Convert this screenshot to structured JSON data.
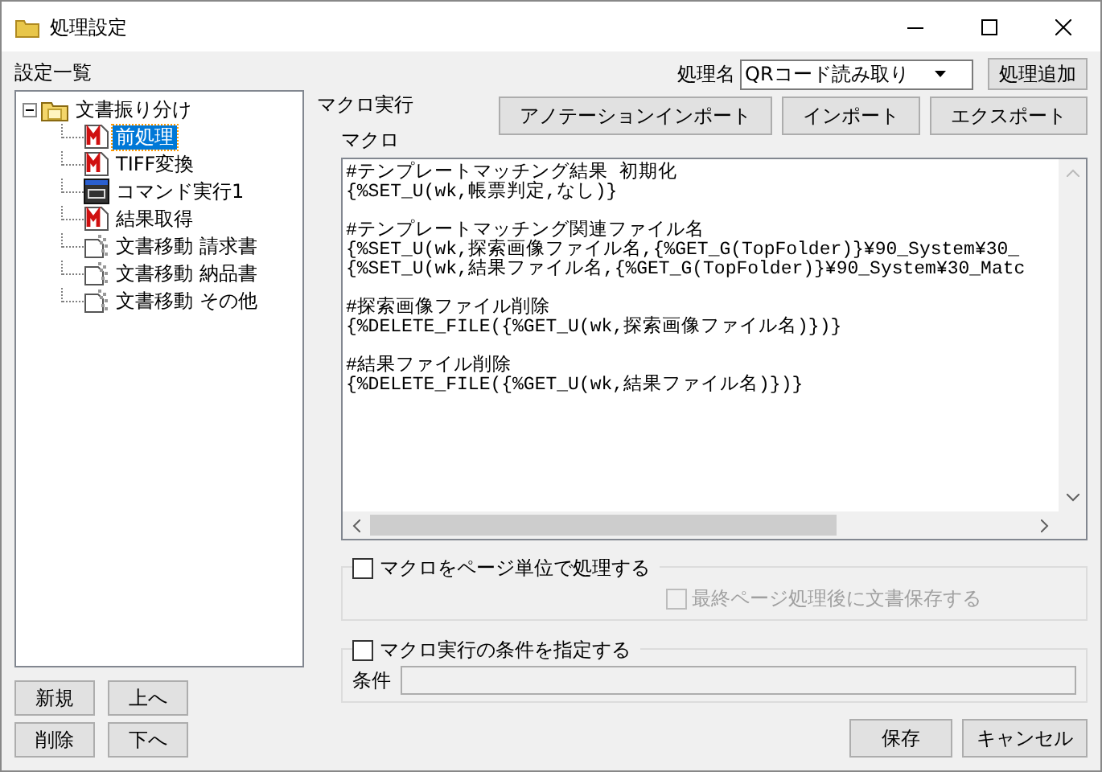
{
  "window": {
    "title": "処理設定"
  },
  "sidebar": {
    "label": "設定一覧",
    "tree": [
      {
        "label": "文書振り分け",
        "kind": "folder",
        "expanded": true,
        "selected": false,
        "children": [
          {
            "label": "前処理",
            "kind": "macro",
            "selected": true
          },
          {
            "label": "TIFF変換",
            "kind": "macro",
            "selected": false
          },
          {
            "label": "コマンド実行1",
            "kind": "command",
            "selected": false
          },
          {
            "label": "結果取得",
            "kind": "macro",
            "selected": false
          },
          {
            "label": "文書移動 請求書",
            "kind": "move",
            "selected": false
          },
          {
            "label": "文書移動 納品書",
            "kind": "move",
            "selected": false
          },
          {
            "label": "文書移動 その他",
            "kind": "move",
            "selected": false
          }
        ]
      }
    ],
    "buttons": [
      "新規",
      "上へ",
      "削除",
      "下へ"
    ]
  },
  "process": {
    "label": "処理名",
    "value": "QRコード読み取り",
    "add_button": "処理追加"
  },
  "macro_section": {
    "title": "マクロ実行",
    "macro_label": "マクロ",
    "buttons": [
      "アノテーションインポート",
      "インポート",
      "エクスポート"
    ],
    "blocks": [
      {
        "lines": [
          "#テンプレートマッチング結果 初期化",
          "{%SET_U(wk,帳票判定,なし)}"
        ]
      },
      {
        "lines": [
          "#テンプレートマッチング関連ファイル名",
          "{%SET_U(wk,探索画像ファイル名,{%GET_G(TopFolder)}¥90_System¥30_",
          "{%SET_U(wk,結果ファイル名,{%GET_G(TopFolder)}¥90_System¥30_Matc"
        ]
      },
      {
        "lines": [
          "#探索画像ファイル削除",
          "{%DELETE_FILE({%GET_U(wk,探索画像ファイル名)})}"
        ]
      },
      {
        "lines": [
          "#結果ファイル削除",
          "{%DELETE_FILE({%GET_U(wk,結果ファイル名)})}"
        ]
      }
    ]
  },
  "page_unit": {
    "label": "マクロをページ単位で処理する",
    "checked": false,
    "sub": {
      "label": "最終ページ処理後に文書保存する",
      "checked": false,
      "disabled": true
    }
  },
  "condition": {
    "label": "マクロ実行の条件を指定する",
    "checked": false,
    "field_label": "条件"
  },
  "footer_buttons": [
    "保存",
    "キャンセル"
  ]
}
